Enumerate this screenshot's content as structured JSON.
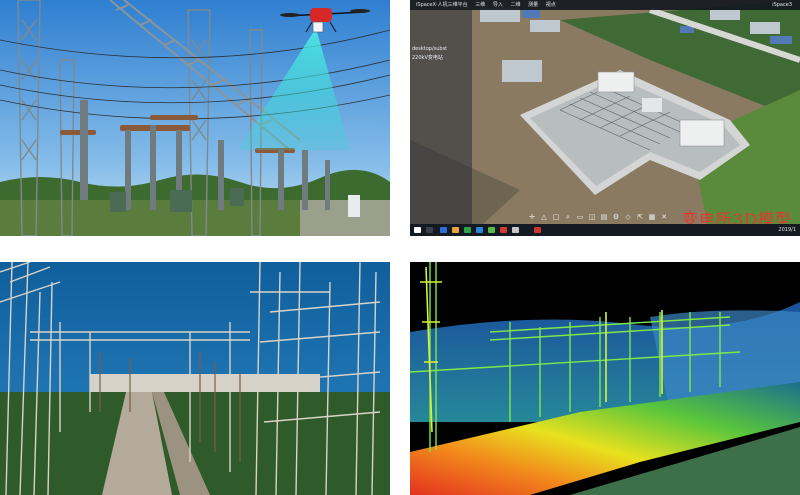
{
  "panels": {
    "drone_inspection": {
      "label": ""
    },
    "model_viewer": {
      "app_title": "iSpaceX·人机三维平台",
      "tabs": [
        "三维",
        "导入",
        "二维",
        "测量",
        "视点"
      ],
      "top_right": "iSpace3",
      "side_items": [
        "desktop/subst",
        "220kV变电站"
      ],
      "taskbar_clock": "2019/1",
      "watermark": "变电所3D模型"
    },
    "substation_pointcloud_rgb": {
      "label": ""
    },
    "substation_pointcloud_elevation": {
      "label": ""
    }
  },
  "colors": {
    "sky": "#3d8ed6",
    "scan_beam": "#39e0d6",
    "watermark": "#e5382e",
    "ground_green": "#6b8d4a"
  },
  "icons": {
    "viewer_toolbar": [
      "cursor-icon",
      "triangle-icon",
      "square-icon",
      "search-icon",
      "box-icon",
      "cube-icon",
      "layers-icon",
      "settings-icon",
      "tag-icon",
      "share-icon",
      "grid-icon",
      "close-icon"
    ]
  }
}
